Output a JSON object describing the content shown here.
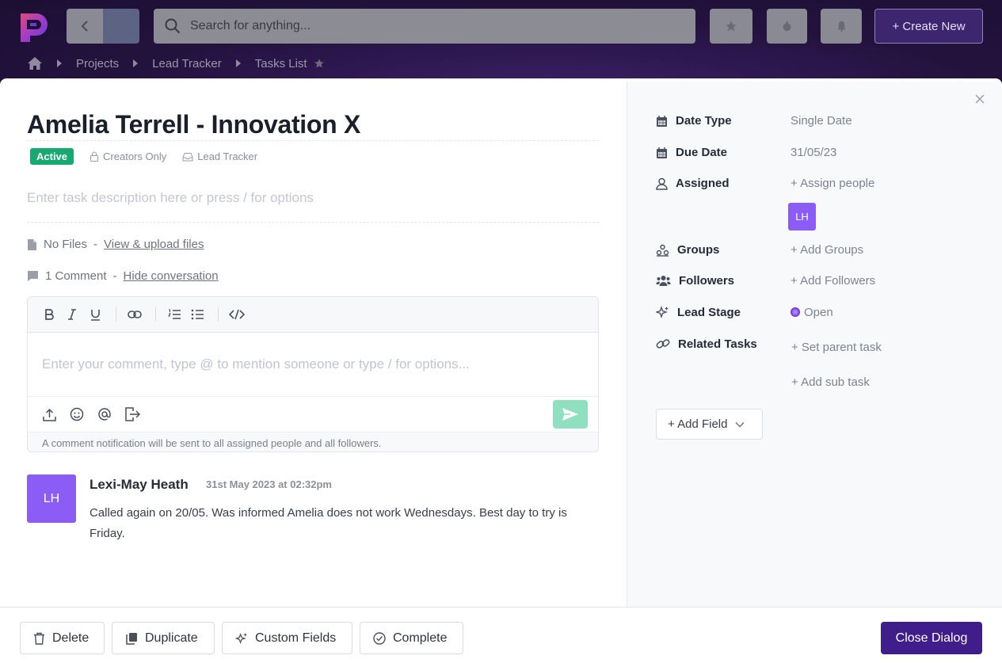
{
  "header": {
    "search_placeholder": "Search for anything...",
    "create_new_label": "+ Create New",
    "breadcrumbs": [
      "Projects",
      "Lead Tracker",
      "Tasks List"
    ]
  },
  "task": {
    "title": "Amelia Terrell - Innovation X",
    "status": "Active",
    "visibility": "Creators Only",
    "project": "Lead Tracker",
    "description_placeholder": "Enter task description here or press / for options",
    "files_text": "No Files",
    "files_link": "View & upload files",
    "comments_text": "1 Comment",
    "comments_link": "Hide conversation",
    "dash": "-"
  },
  "editor": {
    "placeholder": "Enter your comment, type @ to mention someone or type / for options...",
    "note": "A comment notification will be sent to all assigned people and all followers."
  },
  "comment": {
    "initials": "LH",
    "author": "Lexi-May Heath",
    "timestamp": "31st May 2023 at 02:32pm",
    "text": "Called again on 20/05. Was informed Amelia does not work Wednesdays. Best day to try is Friday."
  },
  "sidebar": {
    "date_type_label": "Date Type",
    "date_type_value": "Single Date",
    "due_date_label": "Due Date",
    "due_date_value": "31/05/23",
    "assigned_label": "Assigned",
    "assigned_value": "+ Assign people",
    "assigned_initials": "LH",
    "groups_label": "Groups",
    "groups_value": "+ Add Groups",
    "followers_label": "Followers",
    "followers_value": "+ Add Followers",
    "lead_stage_label": "Lead Stage",
    "lead_stage_value": "Open",
    "related_label": "Related Tasks",
    "related_parent": "+ Set parent task",
    "related_sub": "+ Add sub task",
    "add_field_label": "+ Add Field"
  },
  "footer": {
    "delete": "Delete",
    "duplicate": "Duplicate",
    "custom_fields": "Custom Fields",
    "complete": "Complete",
    "close_dialog": "Close Dialog"
  },
  "colors": {
    "brand": "#3f1d8a",
    "status_active": "#16a970",
    "avatar": "#8b5cf6",
    "send_button": "#8fe0c0"
  }
}
